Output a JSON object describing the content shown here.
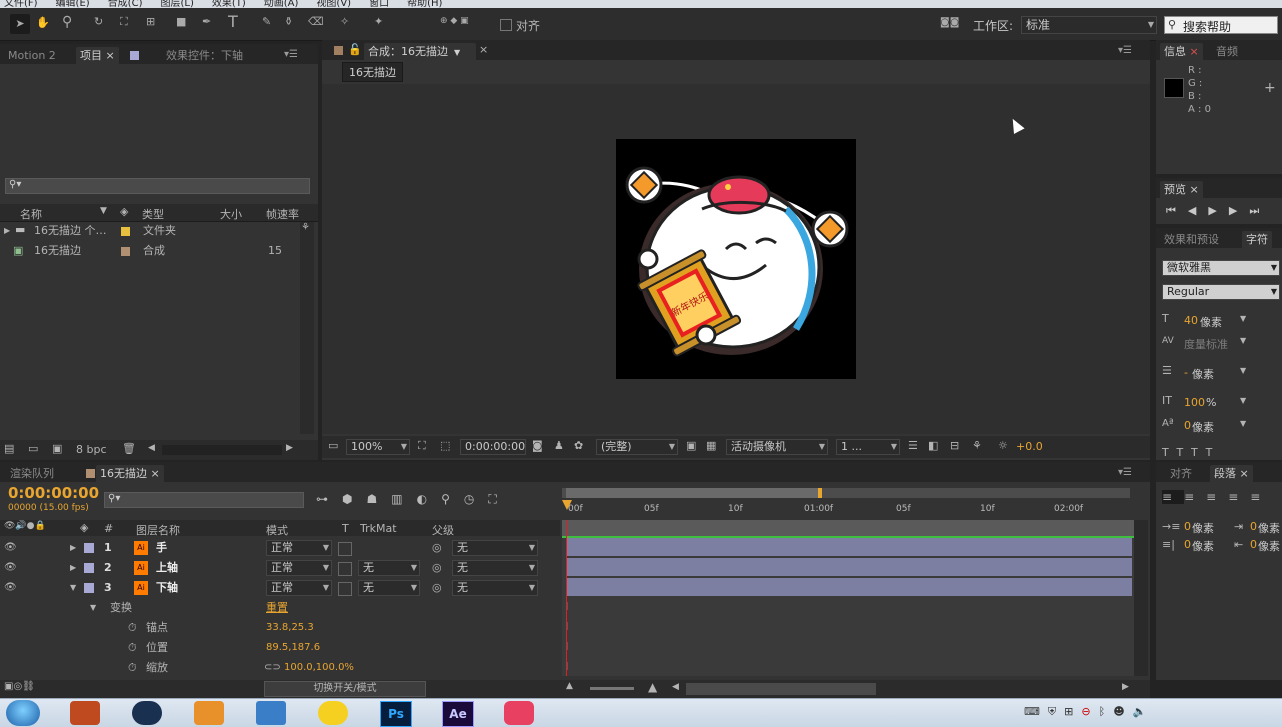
{
  "menubar": {
    "items": [
      "文件(F)",
      "编辑(E)",
      "合成(C)",
      "图层(L)",
      "效果(T)",
      "动画(A)",
      "视图(V)",
      "窗口",
      "帮助(H)"
    ]
  },
  "toolbar": {
    "align_label": "对齐",
    "workspace_label": "工作区:",
    "workspace_value": "标准",
    "search_placeholder": "搜索帮助"
  },
  "project_panel": {
    "tabs": [
      "Motion 2",
      "项目",
      "效果控件：下轴"
    ],
    "columns": [
      "名称",
      "类型",
      "大小",
      "帧速率"
    ],
    "items": [
      {
        "name": "16无描边 个…",
        "type": "文件夹",
        "size": "",
        "fps": "",
        "swatch": "#e8c040"
      },
      {
        "name": "16无描边",
        "type": "合成",
        "size": "",
        "fps": "15",
        "swatch": "#b09070"
      }
    ],
    "bpc": "8 bpc"
  },
  "comp_panel": {
    "tab_title": "合成：16无描边",
    "breadcrumb": "16无描边",
    "zoom": "100%",
    "timecode": "0:00:00:00",
    "resolution": "(完整)",
    "camera": "活动摄像机",
    "views": "1 ...",
    "exposure": "+0.0"
  },
  "info_panel": {
    "tabs": [
      "信息",
      "音频"
    ],
    "rgba": [
      "R :",
      "G :",
      "B :",
      "A : 0"
    ]
  },
  "preview_panel": {
    "title": "预览"
  },
  "char_panel": {
    "tabs": [
      "效果和预设",
      "字符"
    ],
    "font": "微软雅黑",
    "style": "Regular",
    "size_value": "40",
    "size_unit": "像素",
    "kerning": "度量标准",
    "leading_value": "-",
    "leading_unit": "像素",
    "scale_value": "100",
    "scale_unit": "%",
    "baseline_value": "0",
    "baseline_unit": "像素"
  },
  "para_panel": {
    "tabs": [
      "对齐",
      "段落"
    ],
    "indent1_value": "0",
    "indent1_unit": "像素",
    "indent2_value": "0",
    "indent2_unit": "像素",
    "space1_value": "0",
    "space1_unit": "像素",
    "space2_value": "0",
    "space2_unit": "像素"
  },
  "timeline": {
    "tabs": [
      "渲染队列",
      "16无描边"
    ],
    "timecode": "0:00:00:00",
    "frame_info": "00000 (15.00 fps)",
    "columns": [
      "#",
      "图层名称",
      "模式",
      "T",
      "TrkMat",
      "父级"
    ],
    "ruler": [
      "00f",
      "05f",
      "10f",
      "01:00f",
      "05f",
      "10f",
      "02:00f"
    ],
    "layers": [
      {
        "num": "1",
        "name": "手",
        "mode": "正常",
        "trkmat": "",
        "parent": "无"
      },
      {
        "num": "2",
        "name": "上轴",
        "mode": "正常",
        "trkmat": "无",
        "parent": "无"
      },
      {
        "num": "3",
        "name": "下轴",
        "mode": "正常",
        "trkmat": "无",
        "parent": "无"
      }
    ],
    "transform_label": "变换",
    "reset_label": "重置",
    "props": [
      {
        "name": "锚点",
        "value": "33.8,25.3"
      },
      {
        "name": "位置",
        "value": "89.5,187.6"
      },
      {
        "name": "缩放",
        "value": "100.0,100.0%"
      }
    ],
    "toggle_label": "切换开关/模式"
  },
  "artwork": {
    "scroll_text": "新年快乐"
  },
  "taskbar": {
    "apps": [
      "start",
      "game1",
      "lol",
      "game2",
      "media",
      "qq",
      "photoshop",
      "aftereffects",
      "camera"
    ]
  }
}
